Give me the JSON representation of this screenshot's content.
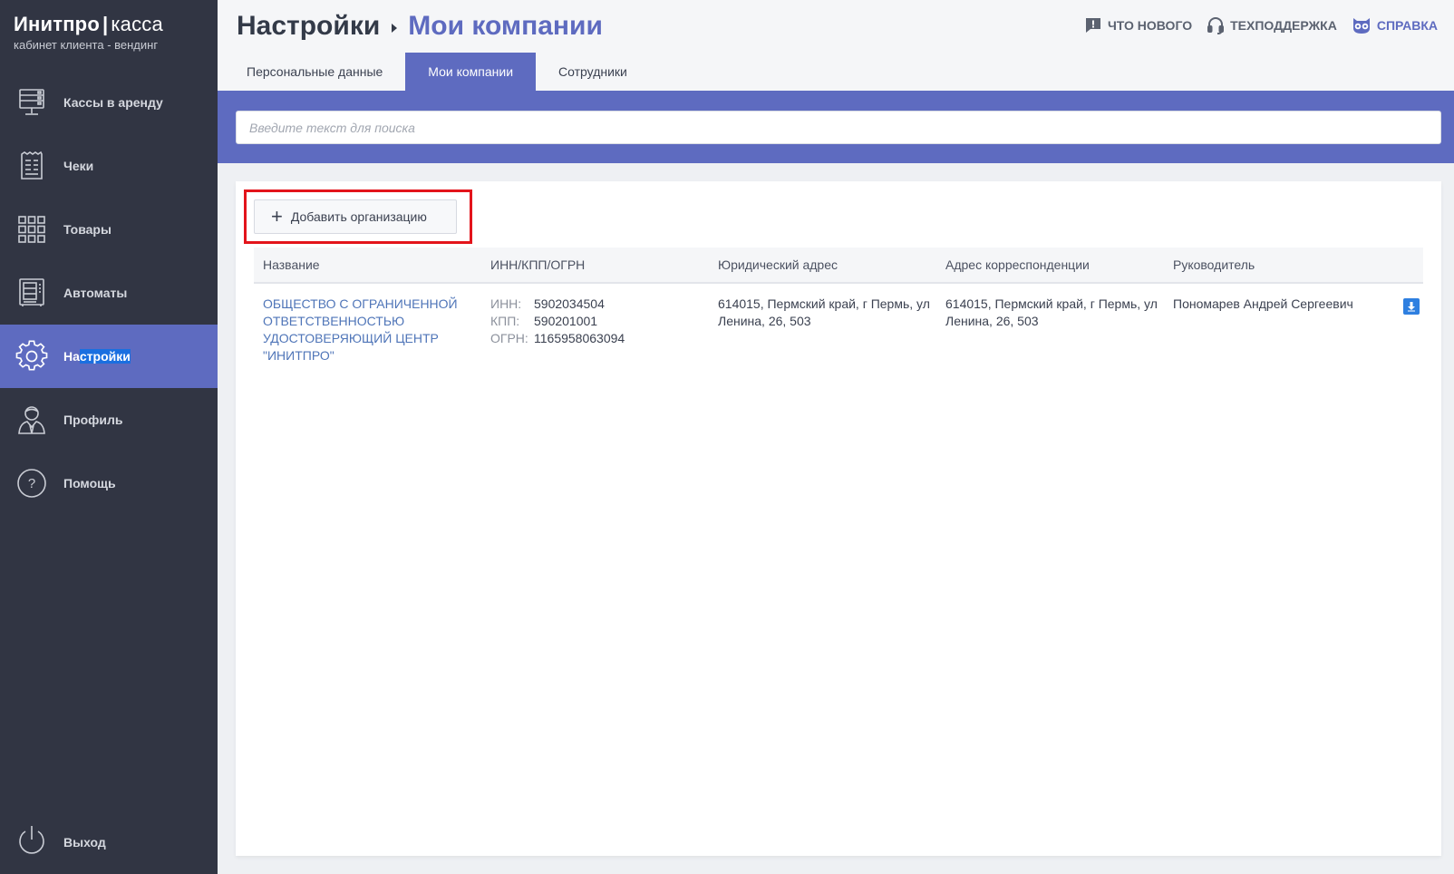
{
  "brand": {
    "name": "Инитпро",
    "separator": "|",
    "product": "касса",
    "subtitle": "кабинет клиента - вендинг"
  },
  "sidebar": {
    "items": [
      {
        "label": "Кассы в аренду",
        "icon": "cash-register-icon"
      },
      {
        "label": "Чеки",
        "icon": "receipt-icon"
      },
      {
        "label": "Товары",
        "icon": "grid-icon"
      },
      {
        "label": "Автоматы",
        "icon": "vending-machine-icon"
      },
      {
        "label": "Настройки",
        "label_prefix": "На",
        "label_selected": "стройки",
        "icon": "gear-icon",
        "active": true
      },
      {
        "label": "Профиль",
        "icon": "user-icon"
      },
      {
        "label": "Помощь",
        "icon": "help-icon"
      }
    ],
    "exit_label": "Выход"
  },
  "header": {
    "breadcrumb_root": "Настройки",
    "breadcrumb_current": "Мои компании",
    "links": {
      "whats_new": "ЧТО НОВОГО",
      "support": "ТЕХПОДДЕРЖКА",
      "help": "СПРАВКА"
    }
  },
  "tabs": [
    {
      "label": "Персональные данные"
    },
    {
      "label": "Мои компании",
      "active": true
    },
    {
      "label": "Сотрудники"
    }
  ],
  "search": {
    "placeholder": "Введите текст для поиска",
    "value": ""
  },
  "actions": {
    "add_org_label": "Добавить организацию"
  },
  "table": {
    "columns": [
      "Название",
      "ИНН/КПП/ОГРН",
      "Юридический адрес",
      "Адрес корреспонденции",
      "Руководитель"
    ],
    "rows": [
      {
        "name": "ОБЩЕСТВО С ОГРАНИЧЕННОЙ ОТВЕТСТВЕННОСТЬЮ УДОСТОВЕРЯЮЩИЙ ЦЕНТР \"ИНИТПРО\"",
        "inn_label": "ИНН:",
        "inn": "5902034504",
        "kpp_label": "КПП:",
        "kpp": "590201001",
        "ogrn_label": "ОГРН:",
        "ogrn": "1165958063094",
        "legal_address": "614015, Пермский край, г Пермь, ул Ленина, 26, 503",
        "mail_address": "614015, Пермский край, г Пермь, ул Ленина, 26, 503",
        "director": "Пономарев Андрей Сергеевич"
      }
    ]
  },
  "colors": {
    "sidebar_bg": "#313543",
    "accent": "#5e6bc0",
    "link": "#4f75b8",
    "highlight_border": "#e3141b",
    "download_btn": "#2e7fe0"
  }
}
